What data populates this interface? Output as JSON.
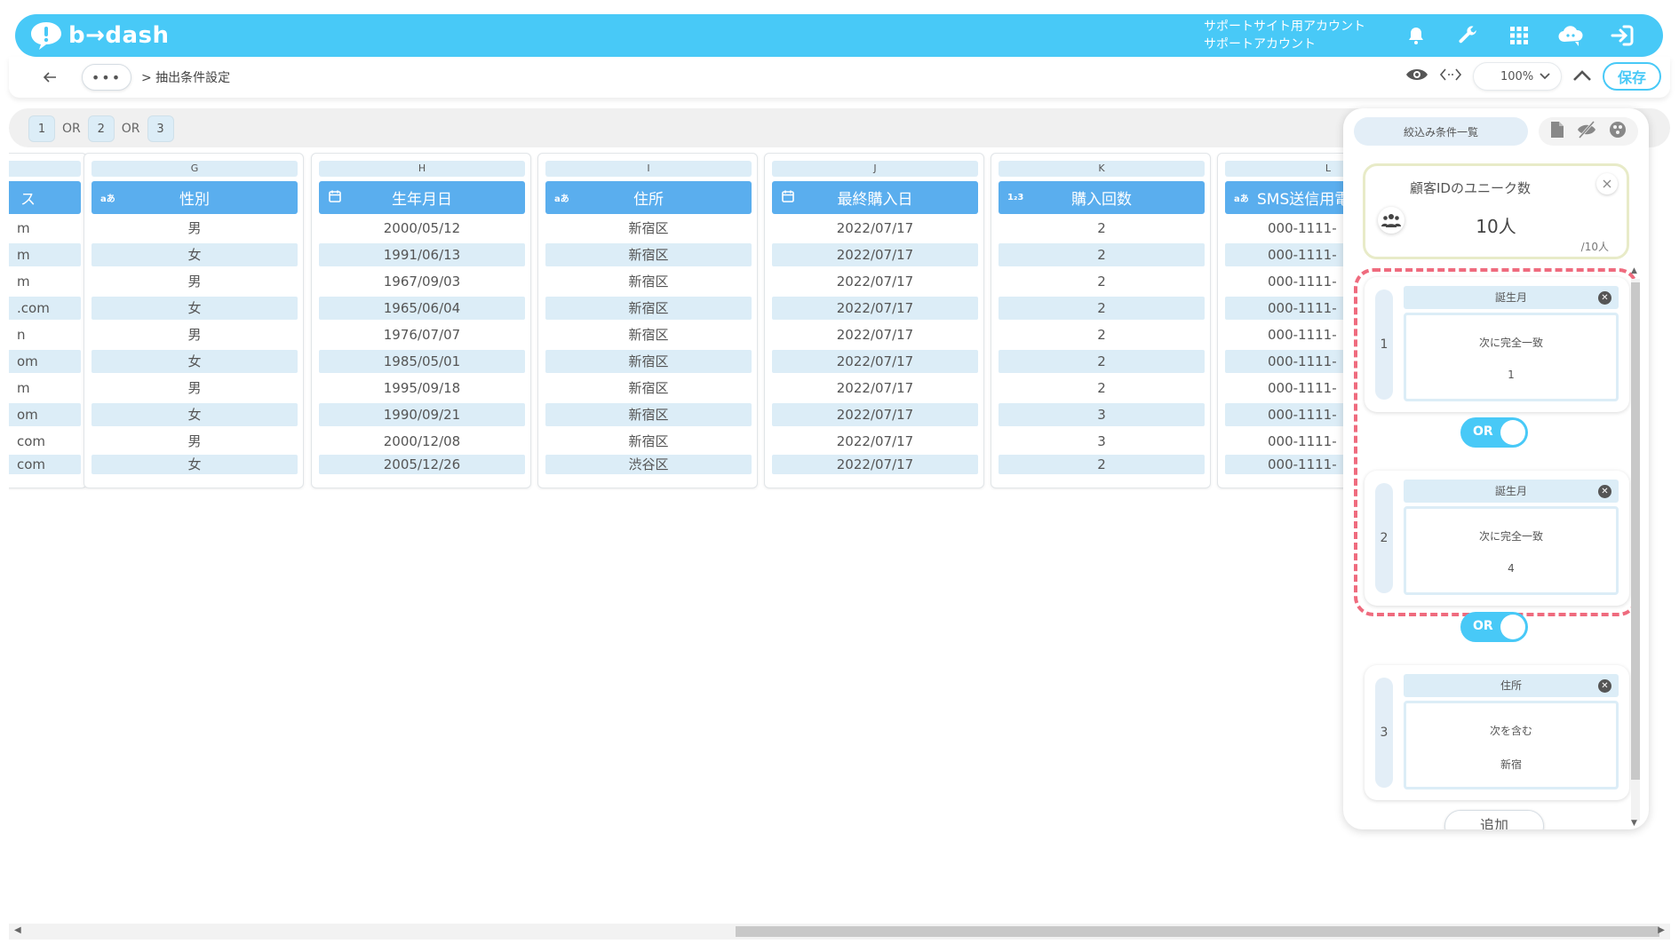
{
  "app": {
    "logo_text": "b→dash"
  },
  "account": {
    "line1": "サポートサイト用アカウント",
    "line2": "サポートアカウント"
  },
  "toolbar": {
    "more": "•••",
    "breadcrumb": "> 抽出条件設定",
    "zoom": "100%",
    "save": "保存"
  },
  "groups": {
    "chips": [
      "1",
      "2",
      "3"
    ],
    "or": "OR"
  },
  "columns": [
    {
      "letter": "",
      "header": "ス",
      "type_icon": "",
      "rows": [
        "m",
        "m",
        "m",
        ".com",
        "n",
        "om",
        "m",
        "om",
        "com",
        "com"
      ]
    },
    {
      "letter": "G",
      "header": "性別",
      "type_icon": "aあ",
      "rows": [
        "男",
        "女",
        "男",
        "女",
        "男",
        "女",
        "男",
        "女",
        "男",
        "女"
      ]
    },
    {
      "letter": "H",
      "header": "生年月日",
      "type_icon": "cal",
      "rows": [
        "2000/05/12",
        "1991/06/13",
        "1967/09/03",
        "1965/06/04",
        "1976/07/07",
        "1985/05/01",
        "1995/09/18",
        "1990/09/21",
        "2000/12/08",
        "2005/12/26"
      ]
    },
    {
      "letter": "I",
      "header": "住所",
      "type_icon": "aあ",
      "rows": [
        "新宿区",
        "新宿区",
        "新宿区",
        "新宿区",
        "新宿区",
        "新宿区",
        "新宿区",
        "新宿区",
        "新宿区",
        "渋谷区"
      ]
    },
    {
      "letter": "J",
      "header": "最終購入日",
      "type_icon": "cal",
      "rows": [
        "2022/07/17",
        "2022/07/17",
        "2022/07/17",
        "2022/07/17",
        "2022/07/17",
        "2022/07/17",
        "2022/07/17",
        "2022/07/17",
        "2022/07/17",
        "2022/07/17"
      ]
    },
    {
      "letter": "K",
      "header": "購入回数",
      "type_icon": "1₂3",
      "rows": [
        "2",
        "2",
        "2",
        "2",
        "2",
        "2",
        "2",
        "3",
        "3",
        "2"
      ]
    },
    {
      "letter": "L",
      "header": "SMS送信用電",
      "type_icon": "aあ",
      "rows": [
        "000-1111-",
        "000-1111-",
        "000-1111-",
        "000-1111-",
        "000-1111-",
        "000-1111-",
        "000-1111-",
        "000-1111-",
        "000-1111-",
        "000-1111-"
      ]
    }
  ],
  "panel": {
    "tab": "絞込み条件一覧",
    "unique": {
      "title": "顧客IDのユニーク数",
      "count": "10人",
      "total": "/10人"
    },
    "conditions": [
      {
        "num": "1",
        "field": "誕生月",
        "operator": "次に完全一致",
        "value": "1"
      },
      {
        "num": "2",
        "field": "誕生月",
        "operator": "次に完全一致",
        "value": "4"
      },
      {
        "num": "3",
        "field": "住所",
        "operator": "次を含む",
        "value": "新宿"
      }
    ],
    "toggles": [
      "OR",
      "OR"
    ],
    "add": "追加"
  },
  "colors": {
    "accent": "#48c9f7",
    "header": "#5aaeee",
    "highlight": "#ef6b7e"
  }
}
